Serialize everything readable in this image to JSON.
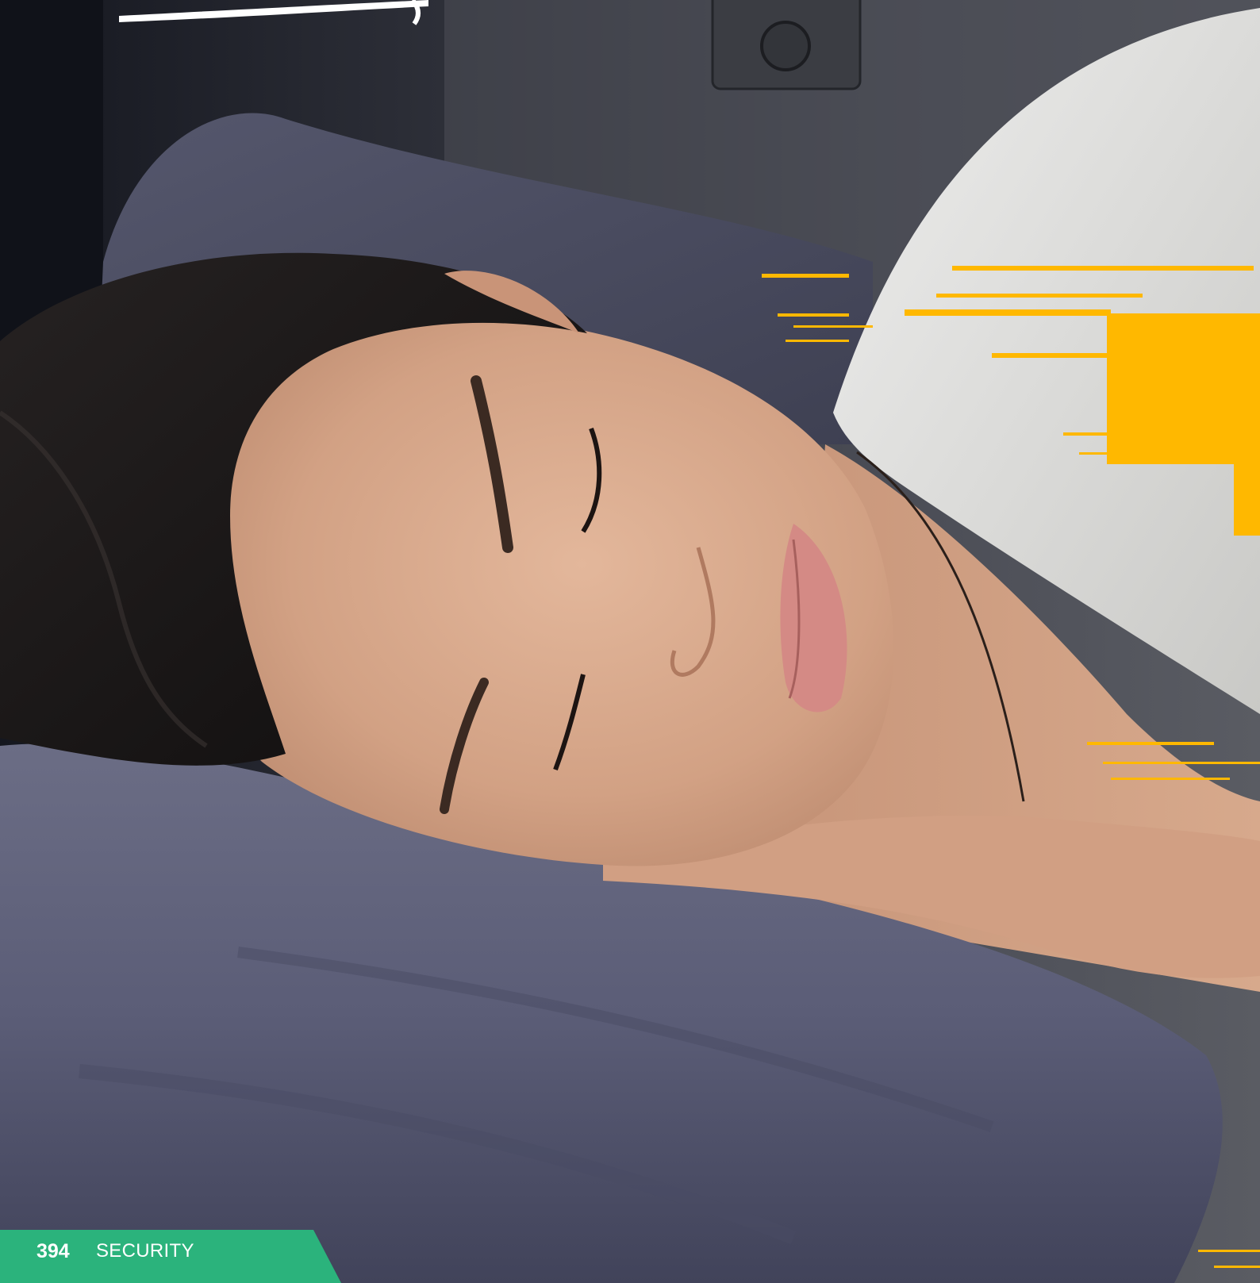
{
  "footer": {
    "page_number": "394",
    "section": "SECURITY"
  },
  "photo": {
    "subject": "woman-sleeping-on-pillow",
    "accent_color": "#FFB800",
    "footer_color": "#2BB37C"
  }
}
